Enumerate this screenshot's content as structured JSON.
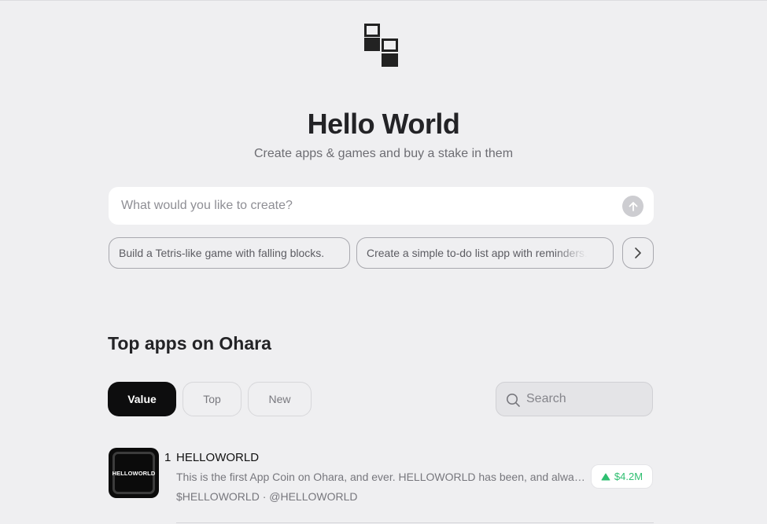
{
  "hero": {
    "title": "Hello World",
    "subtitle": "Create apps & games and buy a stake in them"
  },
  "prompt": {
    "placeholder": "What would you like to create?",
    "value": ""
  },
  "suggestions": [
    "Build a Tetris-like game with falling blocks.",
    "Create a simple to-do list app with reminders."
  ],
  "top_apps": {
    "title": "Top apps on Ohara",
    "tabs": [
      {
        "label": "Value",
        "active": true
      },
      {
        "label": "Top",
        "active": false
      },
      {
        "label": "New",
        "active": false
      }
    ],
    "search_placeholder": "Search",
    "apps": [
      {
        "rank": "1",
        "name": "HELLOWORLD",
        "icon_text": "HELLOWORLD",
        "description": "This is the first App Coin on Ohara, and ever. HELLOWORLD has been, and always will be the first",
        "meta": "$HELLOWORLD · @HELLOWORLD",
        "value": "$4.2M",
        "trend": "up"
      }
    ]
  },
  "colors": {
    "background": "#efeff1",
    "accent_dark": "#0d0d0e",
    "positive": "#2fbf71"
  },
  "icons": [
    "logo-blocks-icon",
    "arrow-up-icon",
    "chevron-right-icon",
    "search-icon",
    "triangle-up-icon"
  ]
}
